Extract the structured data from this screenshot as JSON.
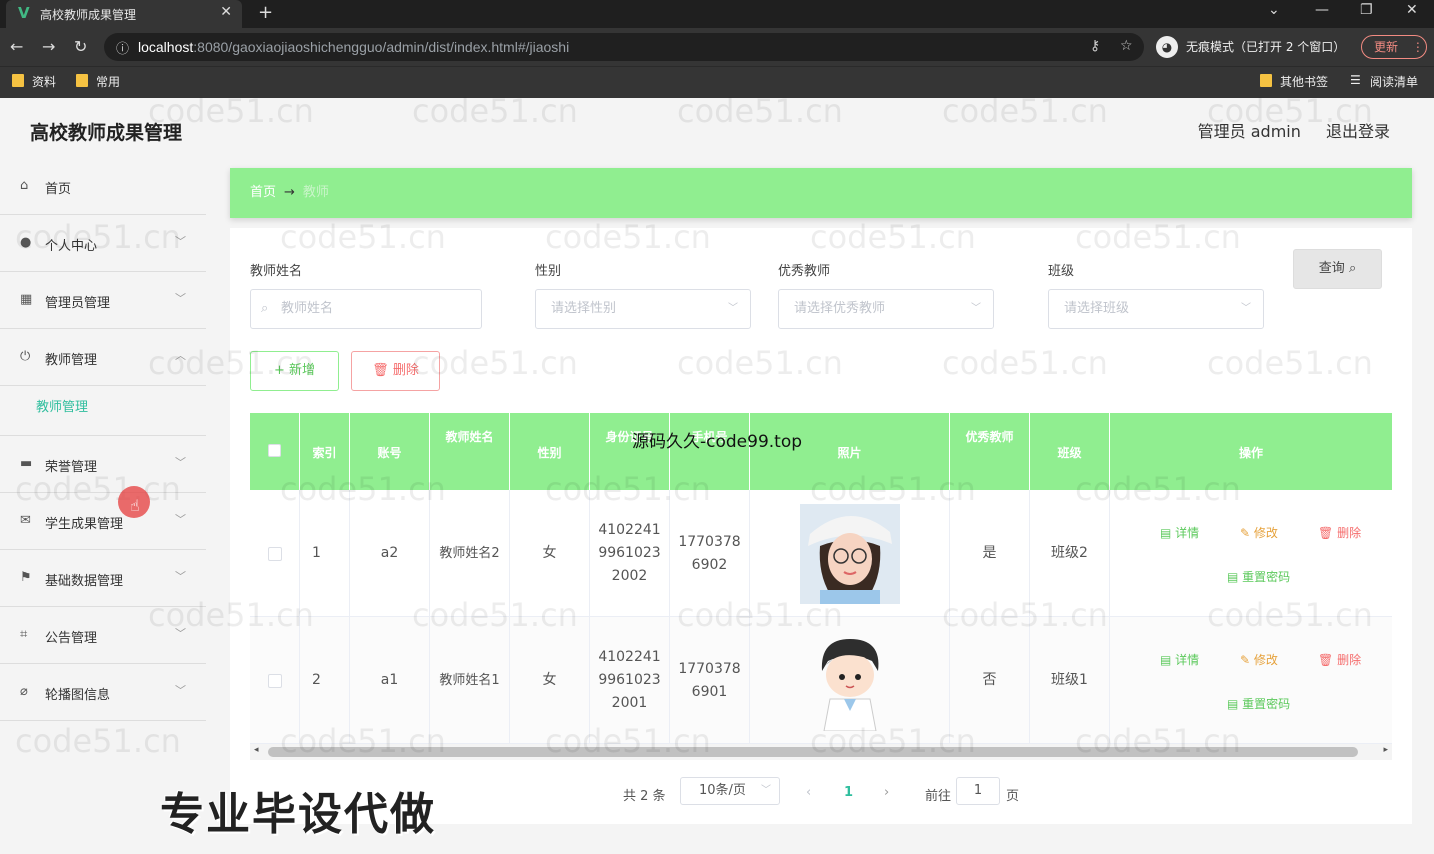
{
  "browser": {
    "tab_title": "高校教师成果管理",
    "url_host": "localhost",
    "url_rest": ":8080/gaoxiaojiaoshichengguo/admin/dist/index.html#/jiaoshi",
    "incognito": "无痕模式（已打开 2 个窗口）",
    "update": "更新",
    "bookmarks": [
      "资料",
      "常用"
    ],
    "other_bookmarks": "其他书签",
    "reading_list": "阅读清单"
  },
  "app": {
    "title": "高校教师成果管理",
    "user": "管理员 admin",
    "logout": "退出登录"
  },
  "sidebar": {
    "items": [
      {
        "label": "首页",
        "icon": "home-icon"
      },
      {
        "label": "个人中心",
        "icon": "user-icon"
      },
      {
        "label": "管理员管理",
        "icon": "grid-icon"
      },
      {
        "label": "教师管理",
        "icon": "power-icon"
      },
      {
        "label": "荣誉管理",
        "icon": "award-icon"
      },
      {
        "label": "学生成果管理",
        "icon": "mail-icon"
      },
      {
        "label": "基础数据管理",
        "icon": "flag-icon"
      },
      {
        "label": "公告管理",
        "icon": "crop-icon"
      },
      {
        "label": "轮播图信息",
        "icon": "bell-off-icon"
      }
    ],
    "submenu": "教师管理"
  },
  "breadcrumb": {
    "home": "首页",
    "current": "教师"
  },
  "filters": {
    "name_label": "教师姓名",
    "name_placeholder": "教师姓名",
    "sex_label": "性别",
    "sex_placeholder": "请选择性别",
    "excellent_label": "优秀教师",
    "excellent_placeholder": "请选择优秀教师",
    "class_label": "班级",
    "class_placeholder": "请选择班级",
    "query": "查询"
  },
  "actions": {
    "add": "新增",
    "delete": "删除"
  },
  "table": {
    "headers": [
      "索引",
      "账号",
      "教师姓名",
      "性别",
      "身份证号",
      "手机号",
      "照片",
      "优秀教师",
      "班级",
      "操作"
    ],
    "rows": [
      {
        "index": "1",
        "account": "a2",
        "name": "教师姓名2",
        "sex": "女",
        "id_card": "410224199610232002",
        "phone": "17703786902",
        "excellent": "是",
        "class": "班级2"
      },
      {
        "index": "2",
        "account": "a1",
        "name": "教师姓名1",
        "sex": "女",
        "id_card": "410224199610232001",
        "phone": "17703786901",
        "excellent": "否",
        "class": "班级1"
      }
    ],
    "row_actions": {
      "detail": "详情",
      "edit": "修改",
      "delete": "删除",
      "reset": "重置密码"
    }
  },
  "pagination": {
    "total": "共 2 条",
    "size": "10条/页",
    "current": "1",
    "goto": "前往",
    "page_input": "1",
    "page_unit": "页"
  },
  "overlays": {
    "watermark": "code51.cn",
    "banner": "源码久久-code99.top",
    "promo": "专业毕设代做"
  },
  "colors": {
    "accent": "#90ee90",
    "submenu": "#2fbe9e",
    "danger": "#f56c6c",
    "warning": "#e6a23c"
  }
}
